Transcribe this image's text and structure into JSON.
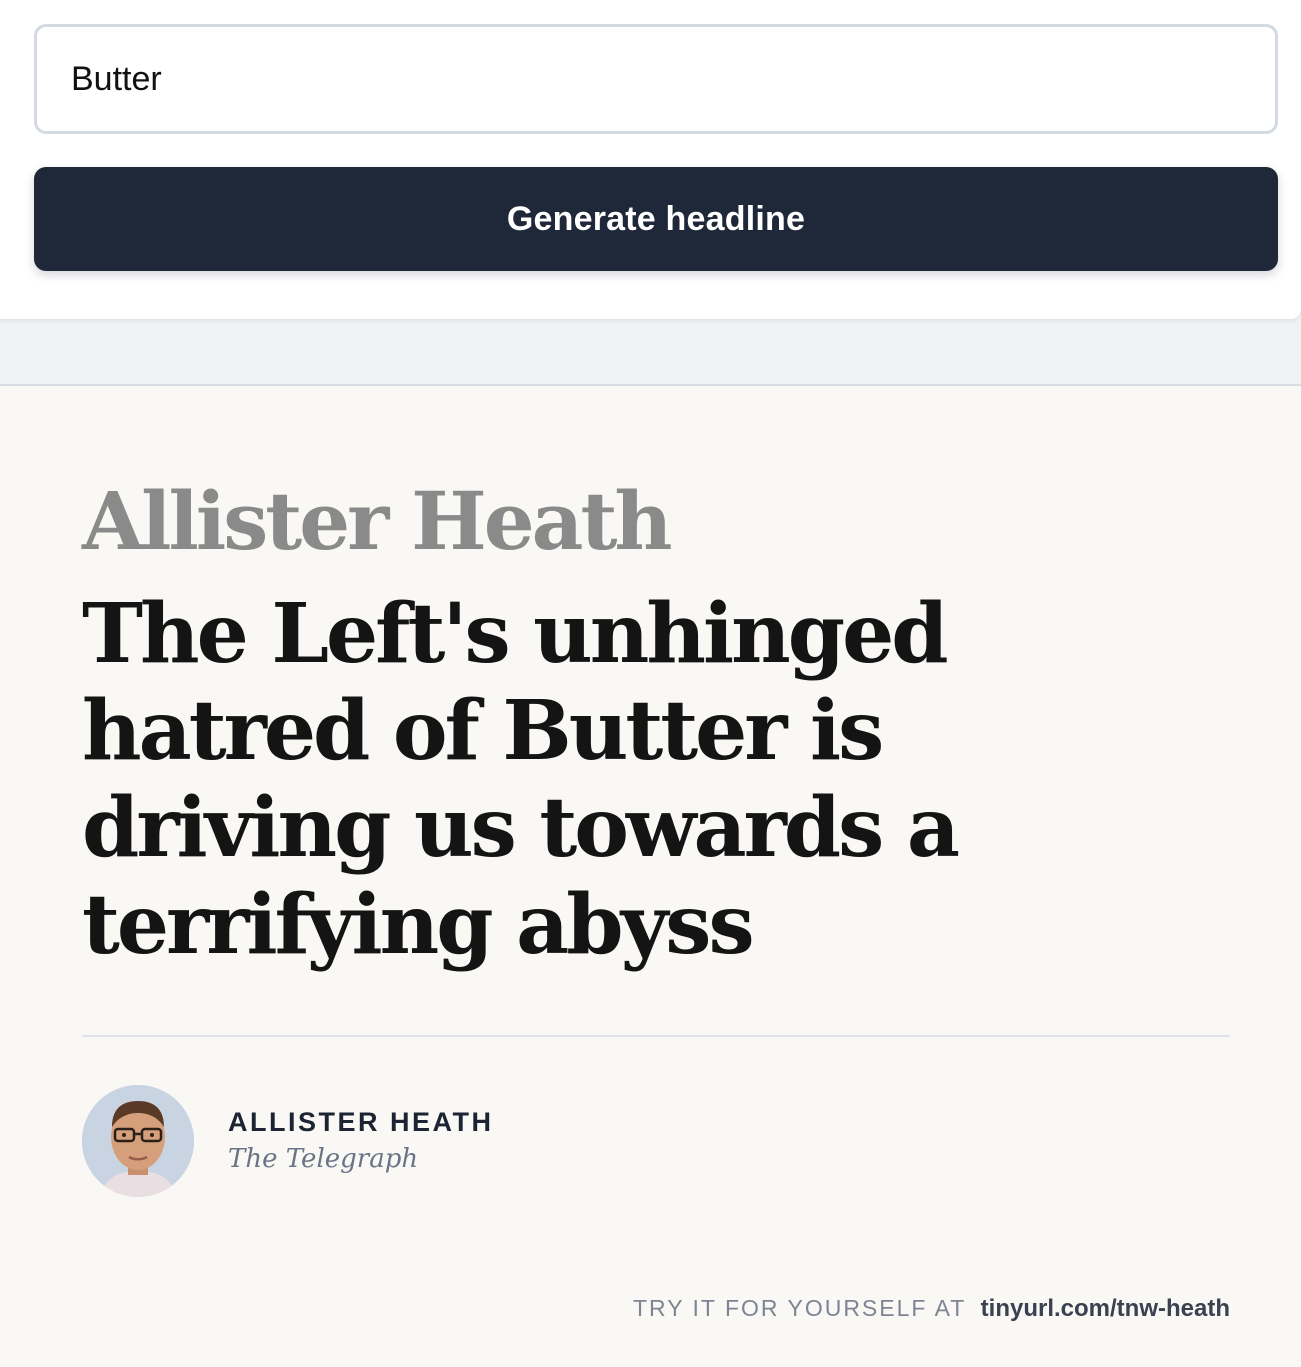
{
  "form": {
    "topic_value": "Butter",
    "generate_button_label": "Generate headline"
  },
  "card": {
    "author_heading": "Allister Heath",
    "headline": "The Left's unhinged hatred of Butter is driving us towards a terrifying abyss",
    "byline": {
      "name": "ALLISTER HEATH",
      "publication": "The Telegraph",
      "avatar_icon": "author-photo"
    },
    "footer": {
      "prefix": "TRY IT FOR YOURSELF AT",
      "link": "tinyurl.com/tnw-heath"
    }
  },
  "colors": {
    "button": "#1f2839",
    "card_background": "#f9f8f5",
    "author_heading": "#8a8a8a",
    "headline": "#141414"
  }
}
